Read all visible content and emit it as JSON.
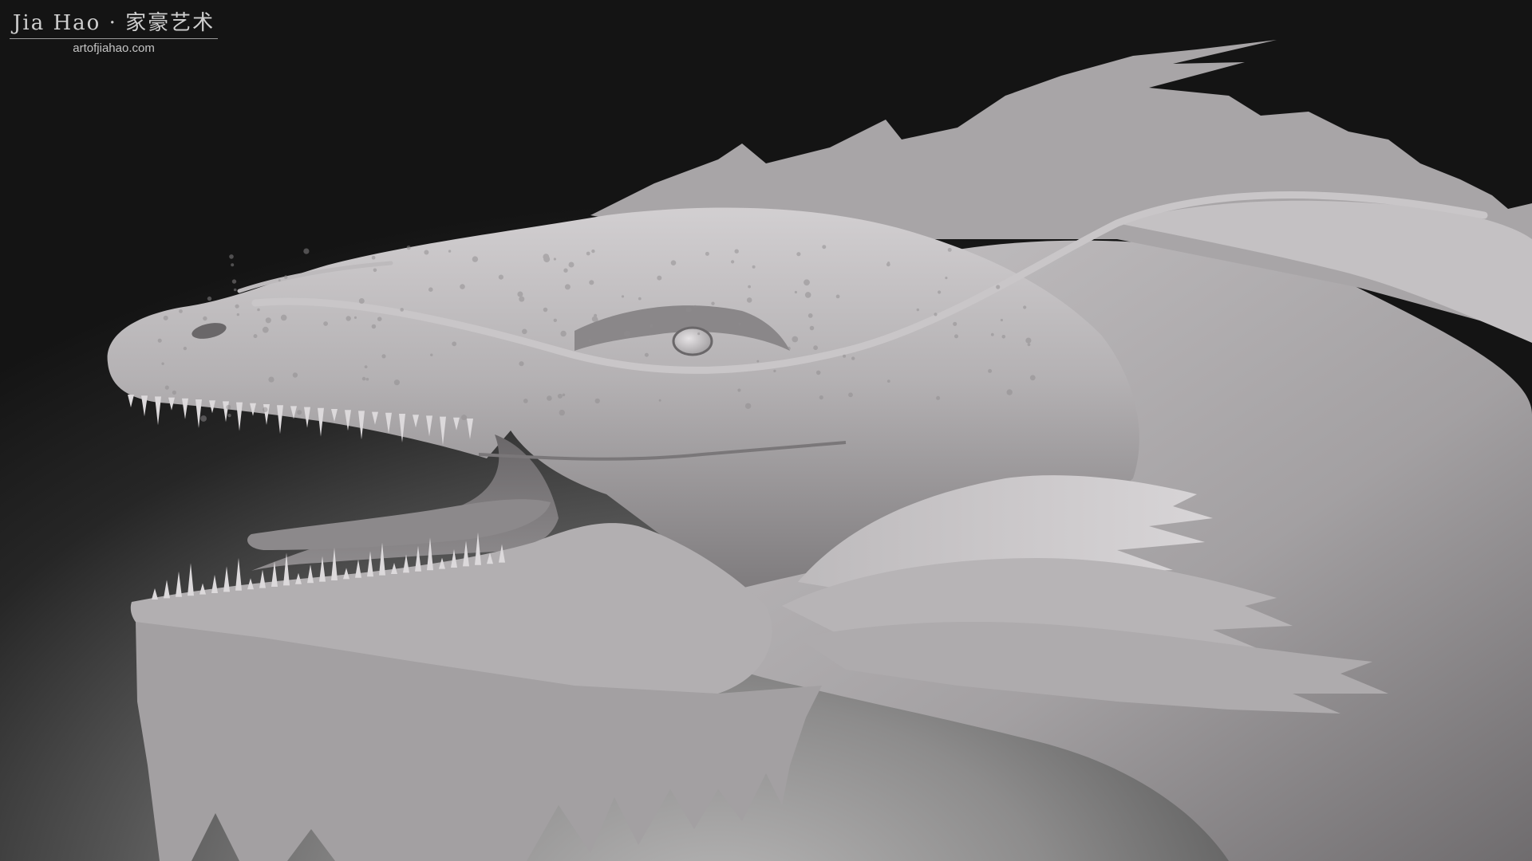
{
  "watermark": {
    "title": "Jia Hao · 家豪艺术",
    "url": "artofjiahao.com"
  },
  "palette": {
    "background_dark": "#141414",
    "background_light": "#b9b8b8",
    "sculpt_clay": "#a9a6a8",
    "sculpt_highlight": "#d6d3d5",
    "sculpt_shadow": "#5e5b5d"
  }
}
